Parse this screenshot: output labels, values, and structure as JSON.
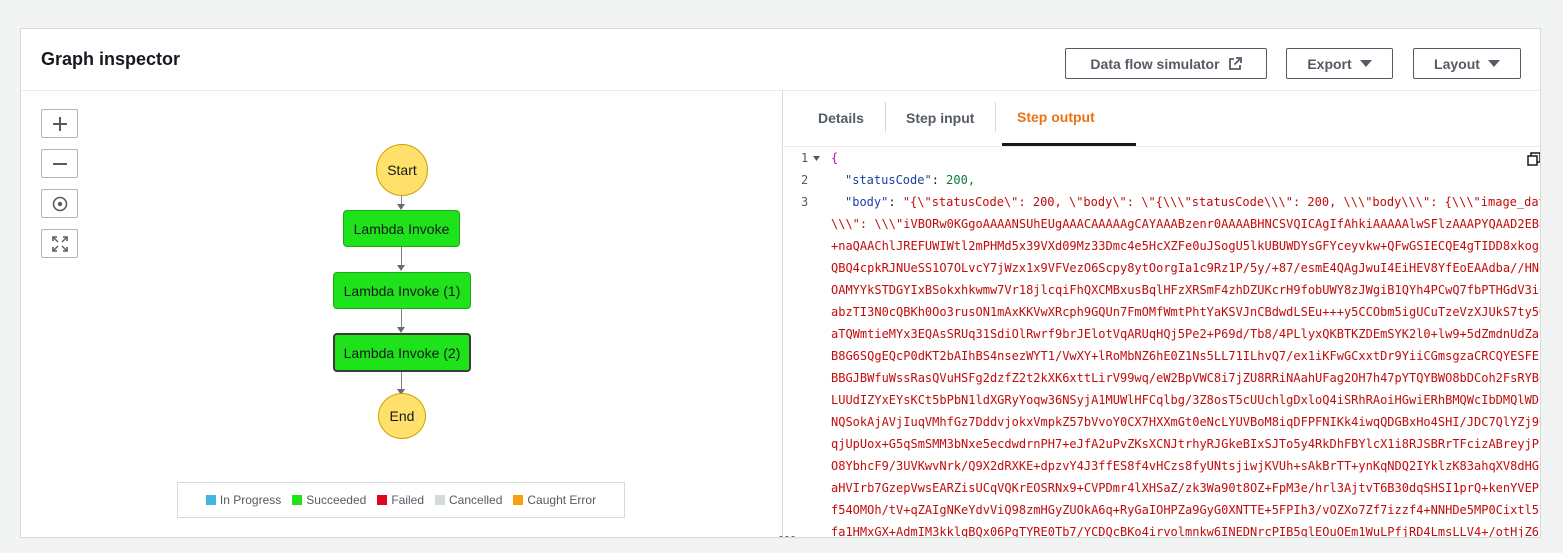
{
  "header": {
    "title": "Graph inspector",
    "data_flow_label": "Data flow simulator",
    "export_label": "Export",
    "layout_label": "Layout"
  },
  "zoom_controls": {
    "zoom_in": "+",
    "zoom_out": "−"
  },
  "graph": {
    "start": "Start",
    "nodes": [
      "Lambda Invoke",
      "Lambda Invoke (1)",
      "Lambda Invoke (2)"
    ],
    "end": "End",
    "colors": {
      "state_circle": "#ffe06b",
      "succeeded": "#1ee31a"
    }
  },
  "legend": [
    {
      "label": "In Progress",
      "color": "#45b6e2"
    },
    {
      "label": "Succeeded",
      "color": "#1ee31a"
    },
    {
      "label": "Failed",
      "color": "#e0071b"
    },
    {
      "label": "Cancelled",
      "color": "#d5dbdb"
    },
    {
      "label": "Caught Error",
      "color": "#f89f0e"
    }
  ],
  "tabs": {
    "details": "Details",
    "step_input": "Step input",
    "step_output": "Step output",
    "active": "Step output",
    "active_color": "#ec7211"
  },
  "code": {
    "line_numbers": [
      "1",
      "2",
      "3"
    ],
    "brace": "{",
    "line2_key": "\"statusCode\"",
    "line2_value": "200,",
    "line3_key": "\"body\"",
    "line3_value": "\"{\\\"statusCode\\\": 200, \\\"body\\\": \\\"{\\\\\\\"statusCode\\\\\\\": 200, \\\\\\\"body\\\\\\\": {\\\\\\\"image_dat",
    "wrapped_lines": [
      "\\\\\\\": \\\\\\\"iVBORw0KGgoAAAANSUhEUgAAACAAAAAgCAYAAABzenr0AAAABHNCSVQICAgIfAhkiAAAAAlwSFlzAAAPYQAAD2EBa",
      "+naQAAChlJREFUWIWtl2mPHMd5x39VXd09Mz33Dmc4e5HcXZFe0uJSogU5lkUBUWDYsGFYceyvkw+QFwGSIECQE4gTIDD8xkogZ",
      "QBQ4cpkRJNUeSS1O7OLvcY7jWzx1x9VFVezO6Scpy8ytOorgIa1c9Rz1P/5y/+87/esmE4QAgJwuI4EiHEV8YfEoEAAdba//HNo",
      "OAMYYkSTDGYIxBSokxhkwmw7Vr18jlcqiFhQXCMBxusBqlHFzXRSmF4zhDZUKcrH9fobUWY8zJWgiB1QYh4PCwQ7fbPTHGdV3iC",
      "abzTI3N0cQBKh0Oo3rusON1mAxKKVwXRcph9GQUn7FmOMfWmtPhtYaKSVJnCBdwdLSEu+++y5CCObm5igUCuTzeVzXJUkS7ty5Q",
      "aTQWmtieMYx3EQAsSRUq31SdiOlRwrf9brJElotVqARUqHQj5Pe2+P69d/Tb8/4PLlyxQKBTKZDEmSYK2l0+lw9+5dZmdnUdZaL",
      "B8G6SQgEQcP0dKT2bAIhBS4nsezWYT1/VwXY+lRoMbNZ6hE0Z1Ns5LL71ILhvQ7/ex1iKFwGCxxtDr9YiiCGmsgzaCRCQYESFEj",
      "BBGJBWfuWssRasQVuHSFg2dzfZ2t2kXK6xttLirV99wq/eW2BpVWC8i7jZU8RRiNAahUFag2OH7h47pYTQYBWO8bDCoh2FsRYBC",
      "LUUdIZYxEYsKCt5bPbN1ldXGRyYoqw36NSyjA1MUWlHFCqlbg/3Z8osT5cUUchlgDxloQ4iSRhRAoiHGwiERhBMQWcIbDMQlWD",
      "NQSokAjAVjIuqVMhfGz7DddvjokxVmpkZ57bVvoY0CX7HXXmGt0eNcLYUVBoM8iqDFPFNIKk4iwqQDGBxHo4SHI/JDC7QlYZj9U",
      "qjUpUox+G5qSmSMM3bNxe5ecdwdrnPH7+eJfA2uPvZKsXCNJtrhyRJGkeBIxSJTo5y4RkDhFBYlcX1i8RJSBRrTFcizABreyjPx",
      "O8YbhcF9/3UVKwvNrk/Q9X2dRXKE+dpzvY4J3ffES8f4vHCzs8fyUNtsjiwjKVUh+sAkBrTT+ynKqNDQ2IYklzK83ahqXV8dHGk",
      "aHVIrb7GzepVwsEARZisUCqVQKrEOSRNx9+CVPDmr4lXHSaZ/zk3Wa90t8OZ+FpM3e/hrl3AjtvT6B30dqSHSI1prQ+kenYVEPF",
      "f54OMOh/tV+qZAIgNKeYdvViQ98zmHGyZUOkA6q+RyGaIOHPZa9GyG0XNTTE+5FPIh3/vOZXo7Zf7izzf4+NNHDe5MP0Cixtl5",
      "fa1HMxGX+AdmIM3kklqBQx06PgTYRE0Tb7/YCDQcBKo4irvolmnkw6INEDNrcPIB5glEOuOEm1WuLPfjRD4LmsLLV4+/otHjZ6j",
      "OnOXNhlmymqCO22Gkd4EcR6RokArTqBGfUSGqAqG6SCZbwnU9MkbW9EA8qIqVKjW9c/QGNRoNmcxvIqtiD4CGoMj4ZqY0kn956x"
    ]
  }
}
